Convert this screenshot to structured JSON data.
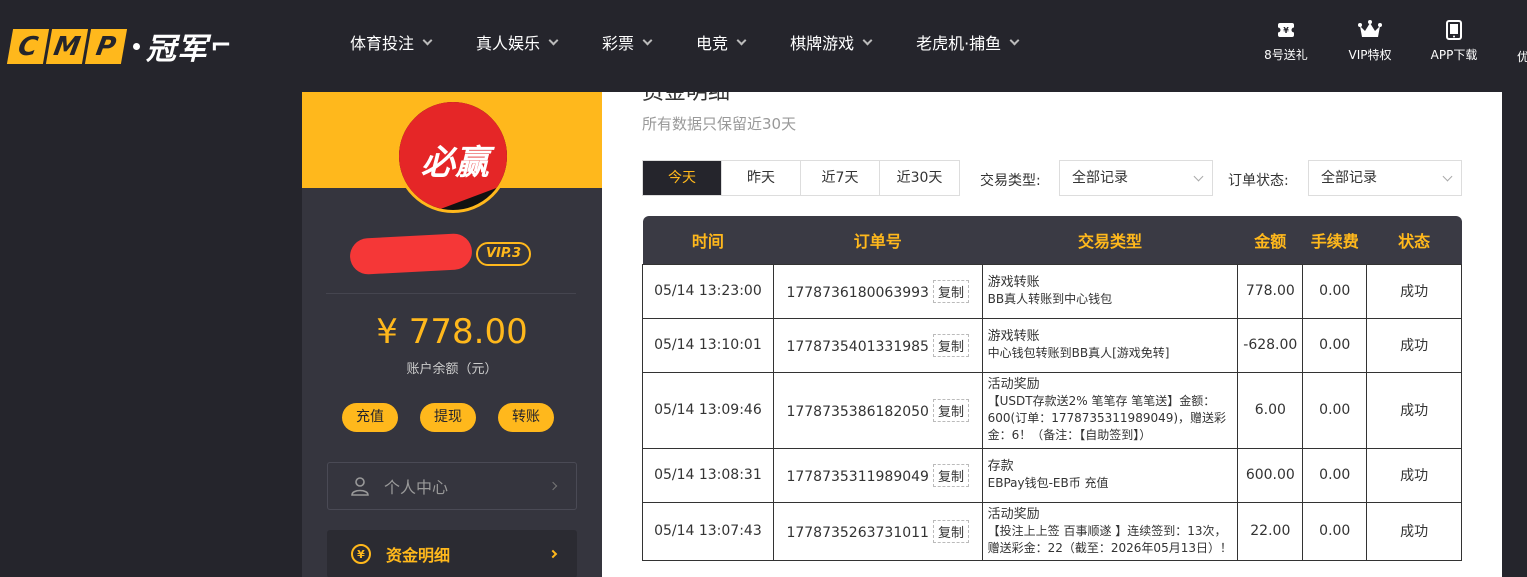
{
  "header": {
    "logo_letters": [
      "C",
      "M",
      "P"
    ],
    "logo_text": "冠军",
    "nav": [
      "体育投注",
      "真人娱乐",
      "彩票",
      "电竞",
      "棋牌游戏",
      "老虎机·捕鱼"
    ],
    "icons": [
      {
        "label": "8号送礼",
        "icon": "ticket-icon"
      },
      {
        "label": "VIP特权",
        "icon": "crown-icon"
      },
      {
        "label": "APP下载",
        "icon": "phone-icon"
      }
    ],
    "overflow_label": "优"
  },
  "sidebar": {
    "avatar_text": "必赢",
    "vip_level": "VIP.3",
    "balance": "¥ 778.00",
    "balance_label": "账户余额（元）",
    "buttons": [
      "充值",
      "提现",
      "转账"
    ],
    "menu": [
      {
        "label": "个人中心",
        "icon": "user-icon",
        "active": false
      },
      {
        "label": "资金明细",
        "icon": "yen-coin-icon",
        "active": true
      }
    ]
  },
  "main": {
    "title": "资金明细",
    "subtitle": "所有数据只保留近30天",
    "ranges": [
      "今天",
      "昨天",
      "近7天",
      "近30天"
    ],
    "active_range": 0,
    "filters": {
      "type_label": "交易类型:",
      "type_value": "全部记录",
      "status_label": "订单状态:",
      "status_value": "全部记录"
    },
    "table": {
      "headers": [
        "时间",
        "订单号",
        "交易类型",
        "金额",
        "手续费",
        "状态"
      ],
      "copy_label": "复制",
      "rows": [
        {
          "time": "05/14 13:23:00",
          "order": "1778736180063993",
          "type": "游戏转账",
          "detail": "BB真人转账到中心钱包",
          "amount": "778.00",
          "fee": "0.00",
          "status": "成功"
        },
        {
          "time": "05/14 13:10:01",
          "order": "1778735401331985",
          "type": "游戏转账",
          "detail": "中心钱包转账到BB真人[游戏免转]",
          "amount": "-628.00",
          "fee": "0.00",
          "status": "成功"
        },
        {
          "time": "05/14 13:09:46",
          "order": "1778735386182050",
          "type": "活动奖励",
          "detail": "【USDT存款送2% 笔笔存 笔笔送】金额：600(订单：1778735311989049)，赠送彩金：6！（备注：【自助签到】）",
          "amount": "6.00",
          "fee": "0.00",
          "status": "成功"
        },
        {
          "time": "05/14 13:08:31",
          "order": "1778735311989049",
          "type": "存款",
          "detail": "EBPay钱包-EB币 充值",
          "amount": "600.00",
          "fee": "0.00",
          "status": "成功"
        },
        {
          "time": "05/14 13:07:43",
          "order": "1778735263731011",
          "type": "活动奖励",
          "detail": "【投注上上签 百事顺遂 】连续签到：13次，赠送彩金：22（截至：2026年05月13日）！",
          "amount": "22.00",
          "fee": "0.00",
          "status": "成功"
        }
      ]
    }
  }
}
